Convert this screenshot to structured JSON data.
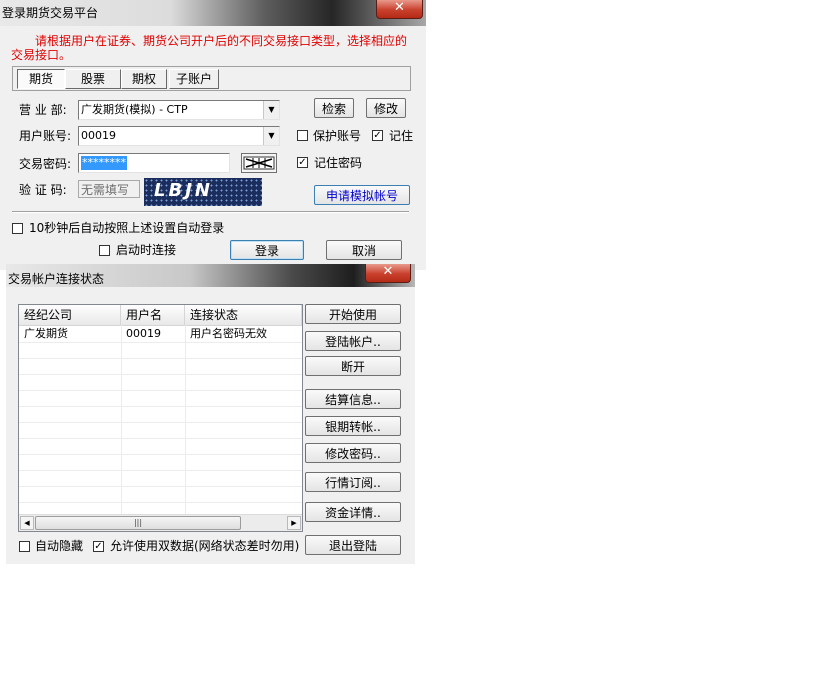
{
  "login_window": {
    "title": "登录期货交易平台",
    "close_glyph": "✕",
    "notice": "请根据用户在证券、期货公司开户后的不同交易接口类型，选择相应的交易接口。",
    "tabs": [
      {
        "label": "期货",
        "active": true
      },
      {
        "label": "股票",
        "active": false
      },
      {
        "label": "期权",
        "active": false
      },
      {
        "label": "子账户",
        "active": false
      }
    ],
    "branch_label": "营 业 部:",
    "branch_value": "广发期货(模拟) - CTP",
    "search_button": "检索",
    "modify_button": "修改",
    "account_label": "用户账号:",
    "account_value": "00019",
    "protect_account_label": "保护账号",
    "protect_account_checked": false,
    "remember_label": "记住",
    "remember_checked": true,
    "password_label": "交易密码:",
    "password_value": "********",
    "remember_password_label": "记住密码",
    "remember_password_checked": true,
    "captcha_label": "验 证 码:",
    "captcha_placeholder": "无需填写",
    "captcha_code": "LBJN",
    "apply_demo_button": "申请模拟帐号",
    "auto_login_label": "10秒钟后自动按照上述设置自动登录",
    "auto_login_checked": false,
    "connect_on_start_label": "启动时连接",
    "connect_on_start_checked": false,
    "login_button": "登录",
    "cancel_button": "取消"
  },
  "status_window": {
    "title": "交易帐户连接状态",
    "close_glyph": "✕",
    "columns": [
      "经纪公司",
      "用户名",
      "连接状态"
    ],
    "rows": [
      [
        "广发期货",
        "00019",
        "用户名密码无效"
      ]
    ],
    "buttons": {
      "start": "开始使用",
      "login_account": "登陆帐户..",
      "disconnect": "断开",
      "settlement": "结算信息..",
      "bank_transfer": "银期转帐..",
      "change_password": "修改密码..",
      "market_subscribe": "行情订阅..",
      "fund_details": "资金详情..",
      "logout": "退出登陆"
    },
    "auto_hide_label": "自动隐藏",
    "auto_hide_checked": false,
    "dual_data_label": "允许使用双数据(网络状态差时勿用)",
    "dual_data_checked": true,
    "scroll_left": "◀",
    "scroll_right": "▶",
    "scroll_grip": "|||"
  }
}
